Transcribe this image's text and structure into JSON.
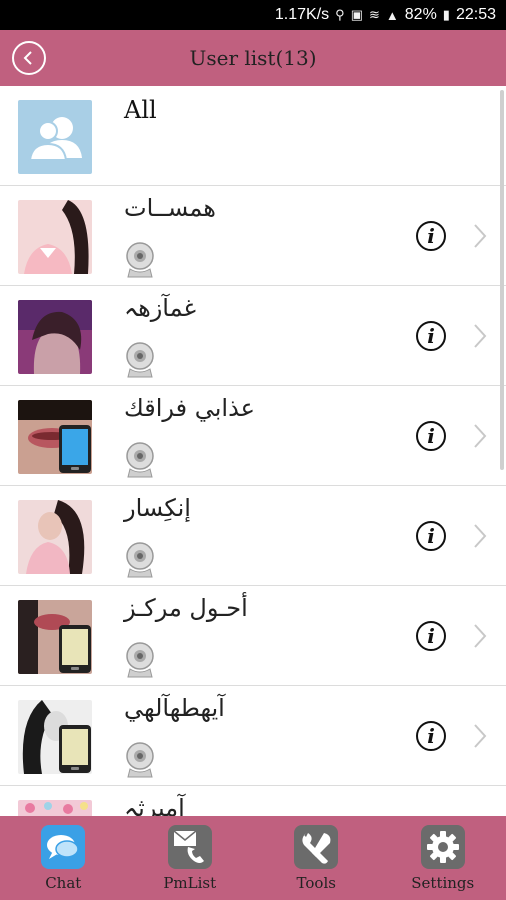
{
  "status_bar": {
    "speed": "1.17K/s",
    "battery": "82%",
    "time": "22:53",
    "icons": [
      "location-icon",
      "nfc-icon",
      "wifi-icon",
      "4g-icon",
      "signal-icon",
      "battery-icon"
    ]
  },
  "header": {
    "title": "User list",
    "count": "(13)",
    "back_icon": "back-arrow-icon"
  },
  "all_row": {
    "label": "All",
    "icon": "group-icon"
  },
  "users": [
    {
      "name": "همســات"
    },
    {
      "name": "غمآزهہ"
    },
    {
      "name": "عذابي فراقك"
    },
    {
      "name": "إنكِسار"
    },
    {
      "name": "أحـول مركـز"
    },
    {
      "name": "آيهطهآلهي"
    },
    {
      "name": "آمبرثہ"
    }
  ],
  "bottom_nav": [
    {
      "label": "Chat",
      "icon": "chat-bubble-icon",
      "color": "#3aa0e6"
    },
    {
      "label": "PmList",
      "icon": "phone-mail-icon",
      "color": "#6b6b6b"
    },
    {
      "label": "Tools",
      "icon": "wrench-icon",
      "color": "#6b6b6b"
    },
    {
      "label": "Settings",
      "icon": "gear-icon",
      "color": "#6b6b6b"
    }
  ],
  "colors": {
    "accent": "#c0607f",
    "status_bar": "#000000"
  }
}
